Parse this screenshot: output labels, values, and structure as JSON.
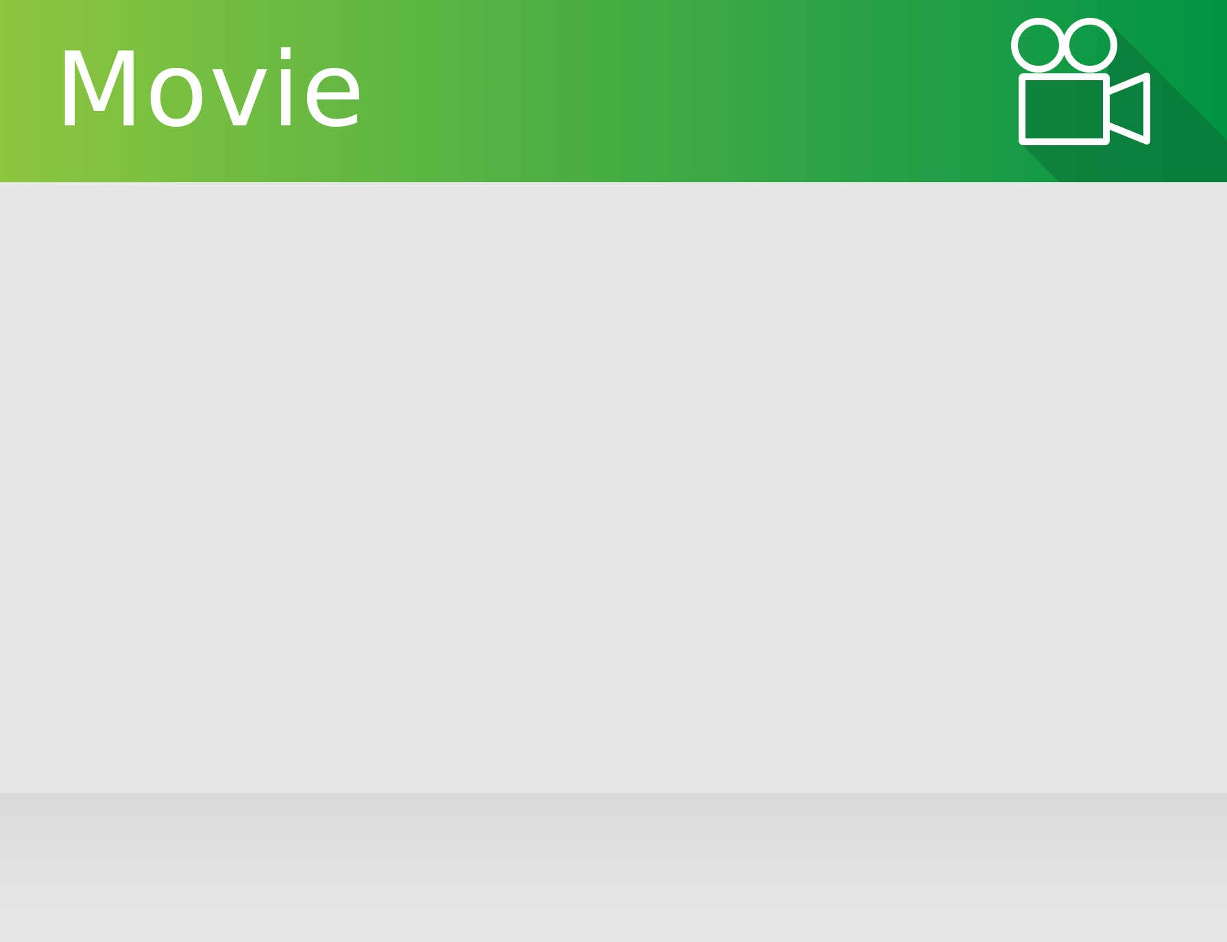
{
  "header": {
    "title": "Movie",
    "icon": "movie-camera-icon",
    "gradient_start": "#8dc63f",
    "gradient_end": "#009444",
    "icon_color": "#ffffff",
    "shadow_color": "#0b6e35"
  },
  "content": {
    "background": "#e7e7e7"
  },
  "footer": {
    "background": "#dcdcdc"
  }
}
